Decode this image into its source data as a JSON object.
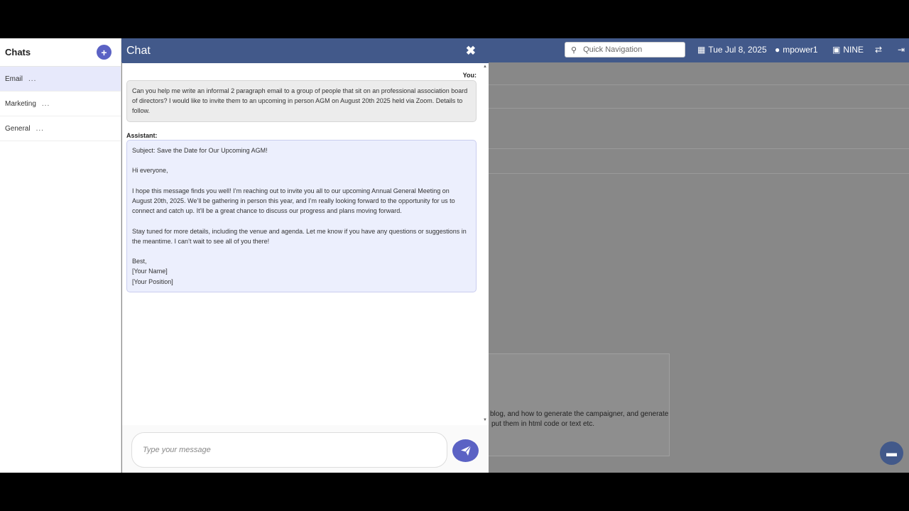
{
  "topbar": {
    "search_placeholder": "Quick Navigation",
    "date": "Tue Jul 8, 2025",
    "user": "mpower1",
    "org": "NINE",
    "icons": {
      "search": "search-icon",
      "calendar": "calendar-icon",
      "user": "user-icon",
      "org": "building-icon",
      "switch": "switch-icon",
      "logout": "logout-icon"
    }
  },
  "sidebar": {
    "title": "Chats",
    "new_button": "+",
    "items": [
      {
        "label": "Email",
        "more": "...",
        "active": true
      },
      {
        "label": "Marketing",
        "more": "..."
      },
      {
        "label": "General",
        "more": "..."
      }
    ]
  },
  "chat": {
    "title": "Chat",
    "close": "✖",
    "user_label": "You:",
    "user_message": "Can you help me write an informal 2 paragraph email to a group of people that sit on an professional association board of directors? I would like to invite them to an upcoming in person AGM on August 20th 2025 held via Zoom. Details to follow.",
    "assistant_label": "Assistant:",
    "assistant_message": {
      "subject": "Subject: Save the Date for Our Upcoming AGM!",
      "greeting": "Hi everyone,",
      "para1": "I hope this message finds you well! I’m reaching out to invite you all to our upcoming Annual General Meeting on August 20th, 2025. We’ll be gathering in person this year, and I’m really looking forward to the opportunity for us to connect and catch up. It’ll be a great chance to discuss our progress and plans moving forward.",
      "para2": "Stay tuned for more details, including the venue and agenda. Let me know if you have any questions or suggestions in the meantime. I can’t wait to see all of you there!",
      "signoff": "Best,",
      "name": "[Your Name]",
      "position": "[Your Position]"
    },
    "input_placeholder": "Type your message"
  },
  "background": {
    "text_line1": "blog, and how to generate the campaigner, and generate",
    "text_line2": "put them in html code or text etc."
  },
  "colors": {
    "header": "#42598a",
    "accent": "#5b62c4",
    "active_item": "#e7e9fb"
  }
}
